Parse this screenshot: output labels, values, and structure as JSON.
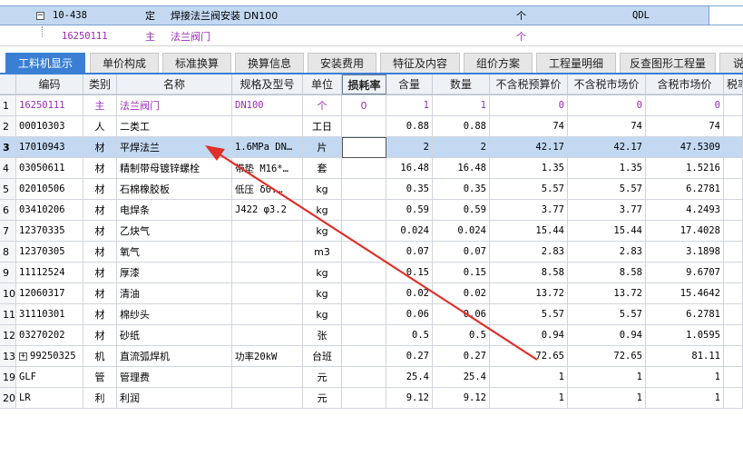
{
  "top_rows": [
    {
      "code": "10-438",
      "type": "定",
      "name": "焊接法兰阀安装 DN100",
      "unit": "个",
      "extra": "QDL"
    },
    {
      "code": "16250111",
      "type": "主",
      "name": "法兰阀门",
      "unit": "个",
      "extra": ""
    }
  ],
  "tabs": [
    "工料机显示",
    "单价构成",
    "标准换算",
    "换算信息",
    "安装费用",
    "特征及内容",
    "组价方案",
    "工程量明细",
    "反查图形工程量",
    "说"
  ],
  "columns": [
    "编码",
    "类别",
    "名称",
    "规格及型号",
    "单位",
    "损耗率",
    "含量",
    "数量",
    "不含税预算价",
    "不含税市场价",
    "含税市场价",
    "税率"
  ],
  "rows": [
    {
      "n": "1",
      "code": "16250111",
      "type": "主",
      "name": "法兰阀门",
      "spec": "DN100",
      "unit": "个",
      "loss": "0",
      "qty": "1",
      "amount": "1",
      "budget": "0",
      "market": "0",
      "taxed": "0",
      "purple": true
    },
    {
      "n": "2",
      "code": "00010303",
      "type": "人",
      "name": "二类工",
      "spec": "",
      "unit": "工日",
      "loss": "",
      "qty": "0.88",
      "amount": "0.88",
      "budget": "74",
      "market": "74",
      "taxed": "74"
    },
    {
      "n": "3",
      "code": "17010943",
      "type": "材",
      "name": "平焊法兰",
      "spec": "1.6MPa DN…",
      "unit": "片",
      "loss": "",
      "qty": "2",
      "amount": "2",
      "budget": "42.17",
      "market": "42.17",
      "taxed": "47.5309",
      "selected": true
    },
    {
      "n": "4",
      "code": "03050611",
      "type": "材",
      "name": "精制带母镀锌螺栓",
      "spec": "带垫 M16*…",
      "unit": "套",
      "loss": "",
      "qty": "16.48",
      "amount": "16.48",
      "budget": "1.35",
      "market": "1.35",
      "taxed": "1.5216"
    },
    {
      "n": "5",
      "code": "02010506",
      "type": "材",
      "name": "石棉橡胶板",
      "spec": "低压 δ0.…",
      "unit": "kg",
      "loss": "",
      "qty": "0.35",
      "amount": "0.35",
      "budget": "5.57",
      "market": "5.57",
      "taxed": "6.2781"
    },
    {
      "n": "6",
      "code": "03410206",
      "type": "材",
      "name": "电焊条",
      "spec": "J422 φ3.2",
      "unit": "kg",
      "loss": "",
      "qty": "0.59",
      "amount": "0.59",
      "budget": "3.77",
      "market": "3.77",
      "taxed": "4.2493"
    },
    {
      "n": "7",
      "code": "12370335",
      "type": "材",
      "name": "乙炔气",
      "spec": "",
      "unit": "kg",
      "loss": "",
      "qty": "0.024",
      "amount": "0.024",
      "budget": "15.44",
      "market": "15.44",
      "taxed": "17.4028"
    },
    {
      "n": "8",
      "code": "12370305",
      "type": "材",
      "name": "氧气",
      "spec": "",
      "unit": "m3",
      "loss": "",
      "qty": "0.07",
      "amount": "0.07",
      "budget": "2.83",
      "market": "2.83",
      "taxed": "3.1898"
    },
    {
      "n": "9",
      "code": "11112524",
      "type": "材",
      "name": "厚漆",
      "spec": "",
      "unit": "kg",
      "loss": "",
      "qty": "0.15",
      "amount": "0.15",
      "budget": "8.58",
      "market": "8.58",
      "taxed": "9.6707"
    },
    {
      "n": "10",
      "code": "12060317",
      "type": "材",
      "name": "清油",
      "spec": "",
      "unit": "kg",
      "loss": "",
      "qty": "0.02",
      "amount": "0.02",
      "budget": "13.72",
      "market": "13.72",
      "taxed": "15.4642"
    },
    {
      "n": "11",
      "code": "31110301",
      "type": "材",
      "name": "棉纱头",
      "spec": "",
      "unit": "kg",
      "loss": "",
      "qty": "0.06",
      "amount": "0.06",
      "budget": "5.57",
      "market": "5.57",
      "taxed": "6.2781"
    },
    {
      "n": "12",
      "code": "03270202",
      "type": "材",
      "name": "砂纸",
      "spec": "",
      "unit": "张",
      "loss": "",
      "qty": "0.5",
      "amount": "0.5",
      "budget": "0.94",
      "market": "0.94",
      "taxed": "1.0595"
    },
    {
      "n": "13",
      "code": "99250325",
      "type": "机",
      "name": "直流弧焊机",
      "spec": "功率20kW",
      "unit": "台班",
      "loss": "",
      "qty": "0.27",
      "amount": "0.27",
      "budget": "72.65",
      "market": "72.65",
      "taxed": "81.11",
      "expand": true
    },
    {
      "n": "19",
      "code": "GLF",
      "type": "管",
      "name": "管理费",
      "spec": "",
      "unit": "元",
      "loss": "",
      "qty": "25.4",
      "amount": "25.4",
      "budget": "1",
      "market": "1",
      "taxed": "1"
    },
    {
      "n": "20",
      "code": "LR",
      "type": "利",
      "name": "利润",
      "spec": "",
      "unit": "元",
      "loss": "",
      "qty": "9.12",
      "amount": "9.12",
      "budget": "1",
      "market": "1",
      "taxed": "1"
    }
  ],
  "colors": {
    "accent": "#3b7fd4",
    "selection": "#c3d9f2",
    "arrow": "#e0302a",
    "main_material": "#9b2bb5"
  },
  "icons": [
    "collapse-minus-icon",
    "expand-plus-icon",
    "annotation-arrow-icon"
  ]
}
